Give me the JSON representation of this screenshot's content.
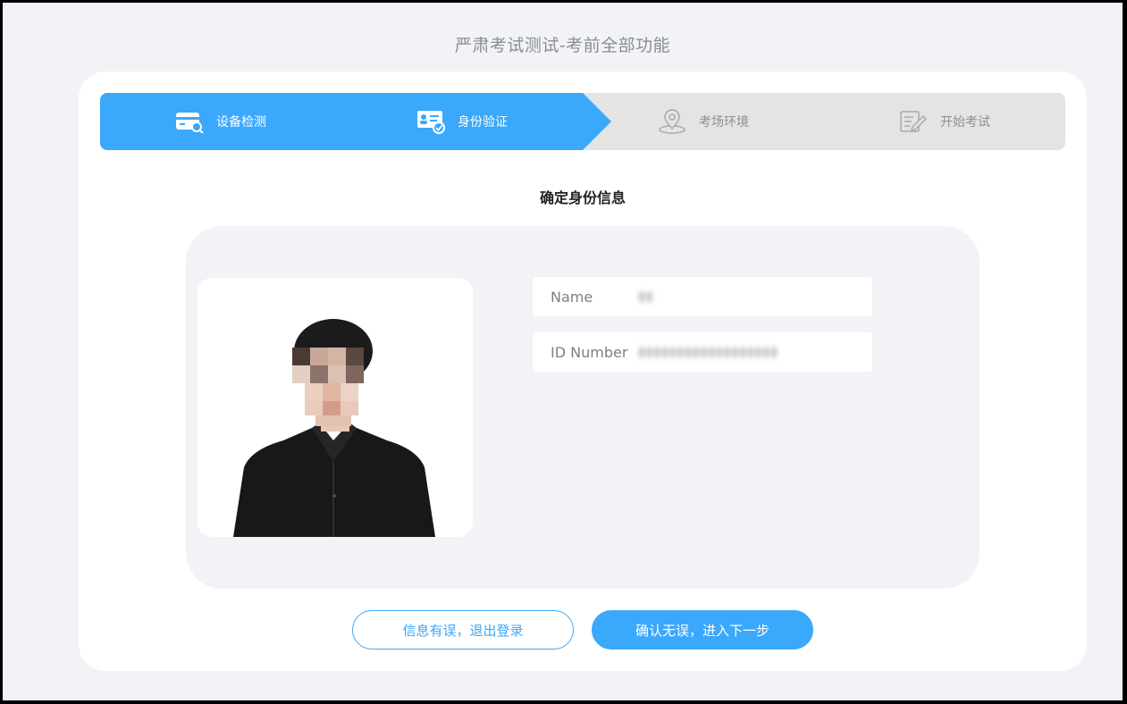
{
  "page": {
    "title": "严肃考试测试-考前全部功能"
  },
  "steps": [
    {
      "label": "设备检测",
      "icon": "device-check-icon",
      "state": "done"
    },
    {
      "label": "身份验证",
      "icon": "id-card-check-icon",
      "state": "current"
    },
    {
      "label": "考场环境",
      "icon": "location-pin-icon",
      "state": "pending"
    },
    {
      "label": "开始考试",
      "icon": "exam-paper-edit-icon",
      "state": "pending"
    }
  ],
  "identity": {
    "title": "确定身份信息",
    "photo_icon": "id-photo",
    "fields": [
      {
        "label": "Name",
        "value": "▮▮"
      },
      {
        "label": "ID Number",
        "value": "▮▮▮▮▮▮▮▮▮▮▮▮▮▮▮▮▮▮"
      }
    ]
  },
  "actions": {
    "reject_label": "信息有误，退出登录",
    "confirm_label": "确认无误，进入下一步"
  },
  "colors": {
    "accent": "#3aa8fb",
    "background": "#f1f3f6",
    "step_inactive": "#e4e4e4"
  }
}
